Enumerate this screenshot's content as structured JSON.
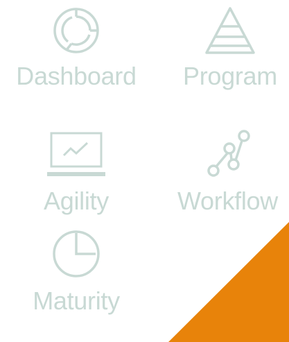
{
  "tiles": {
    "dashboard": {
      "label": "Dashboard",
      "icon": "donut-chart-icon"
    },
    "program": {
      "label": "Program",
      "icon": "pyramid-icon"
    },
    "agility": {
      "label": "Agility",
      "icon": "monitor-trend-icon"
    },
    "workflow": {
      "label": "Workflow",
      "icon": "nodes-path-icon"
    },
    "maturity": {
      "label": "Maturity",
      "icon": "pie-clock-icon"
    }
  },
  "colors": {
    "tile": "#c8d9d4",
    "accent": "#e8830a",
    "background": "#ffffff"
  }
}
